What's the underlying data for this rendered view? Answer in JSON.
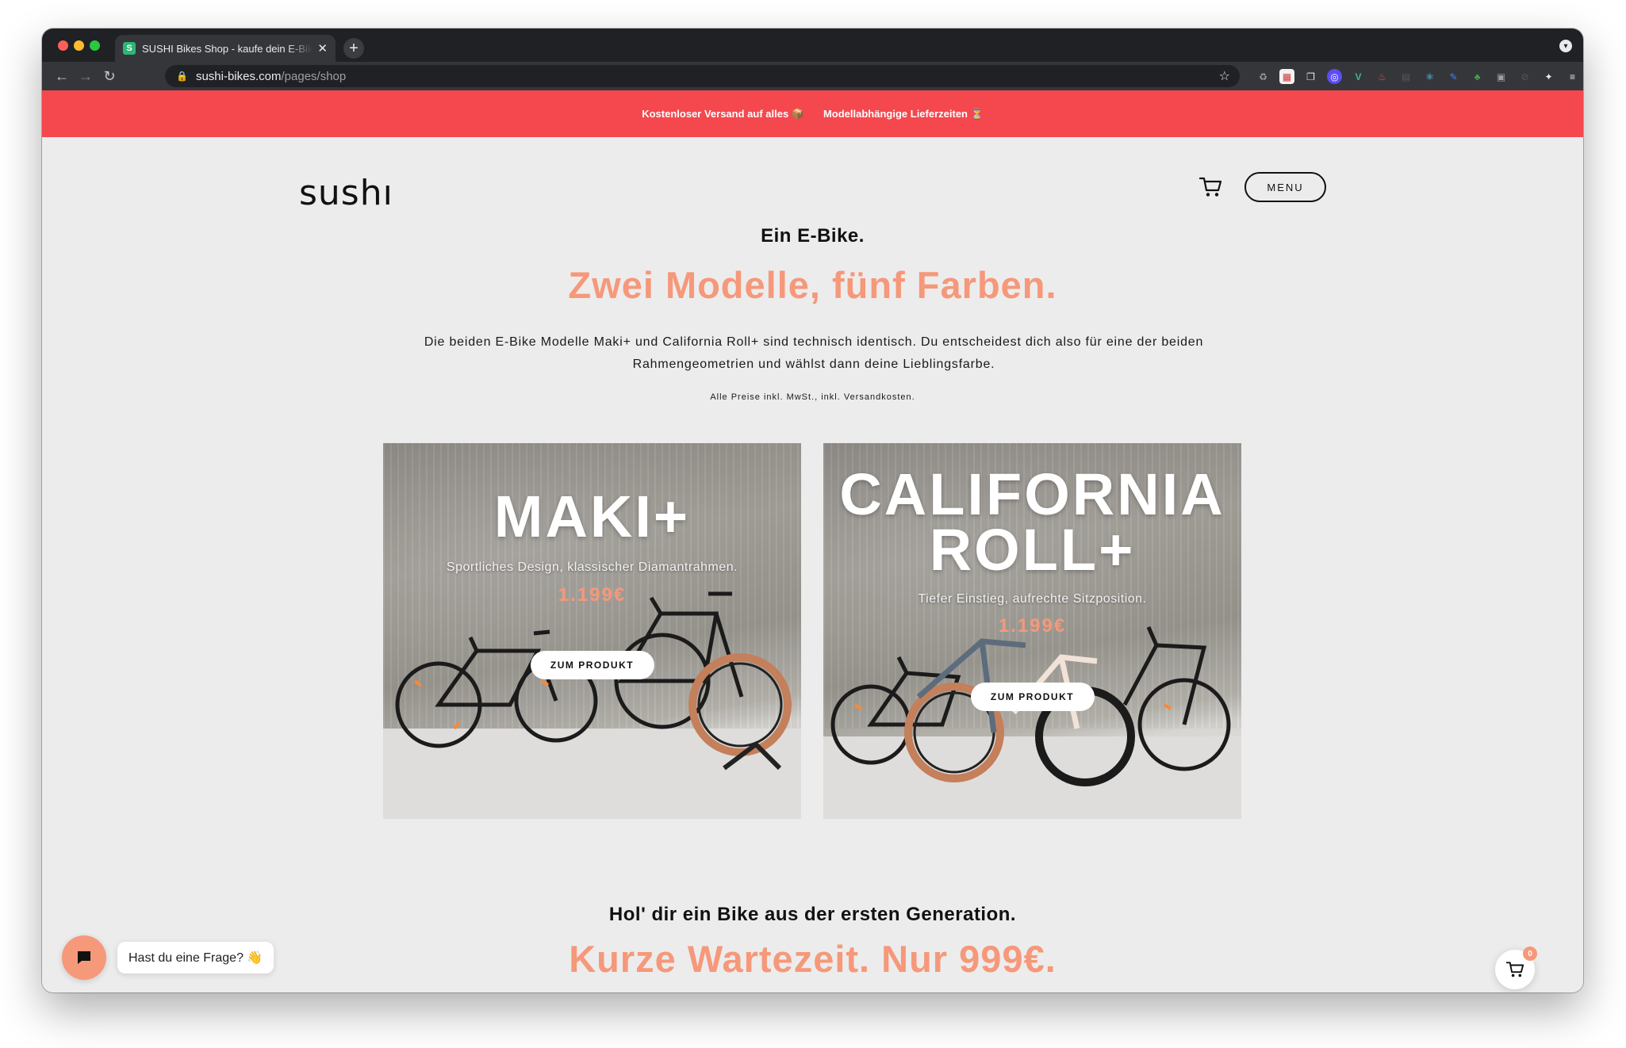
{
  "browser": {
    "tab_title": "SUSHI Bikes Shop - kaufe dein E-Bike",
    "tab_favicon_letter": "S",
    "tab_close": "✕",
    "new_tab": "+",
    "url_host": "sushi-bikes.com",
    "url_path": "/pages/shop",
    "accent_color": "#35363a"
  },
  "announcement": {
    "part1": "Kostenloser Versand auf alles 📦",
    "part2": "Modellabhängige Lieferzeiten ⏳",
    "background": "#f5474e"
  },
  "header": {
    "logo": "sushı",
    "menu_label": "MENU"
  },
  "hero": {
    "kicker": "Ein E-Bike.",
    "headline": "Zwei Modelle, fünf Farben.",
    "intro": "Die beiden E-Bike Modelle Maki+ und California Roll+ sind technisch identisch. Du entscheidest dich also für eine der beiden Rahmengeometrien und wählst dann deine Lieblingsfarbe.",
    "prices_note": "Alle Preise inkl. MwSt., inkl. Versandkosten.",
    "accent_color": "#f6987a"
  },
  "products": [
    {
      "title_line1": "MAKI+",
      "subtitle": "Sportliches Design, klassischer Diamantrahmen.",
      "price": "1.199€",
      "button": "ZUM PRODUKT"
    },
    {
      "title_line1": "CALIFORNIA",
      "title_line2": "ROLL+",
      "subtitle": "Tiefer Einstieg, aufrechte Sitzposition.",
      "price": "1.199€",
      "button": "ZUM PRODUKT"
    }
  ],
  "generation": {
    "subhead": "Hol' dir ein Bike aus der ersten Generation.",
    "headline": "Kurze Wartezeit. Nur 999€."
  },
  "chat": {
    "bubble": "Hast du eine Frage? 👋"
  },
  "cart": {
    "count": "0"
  }
}
